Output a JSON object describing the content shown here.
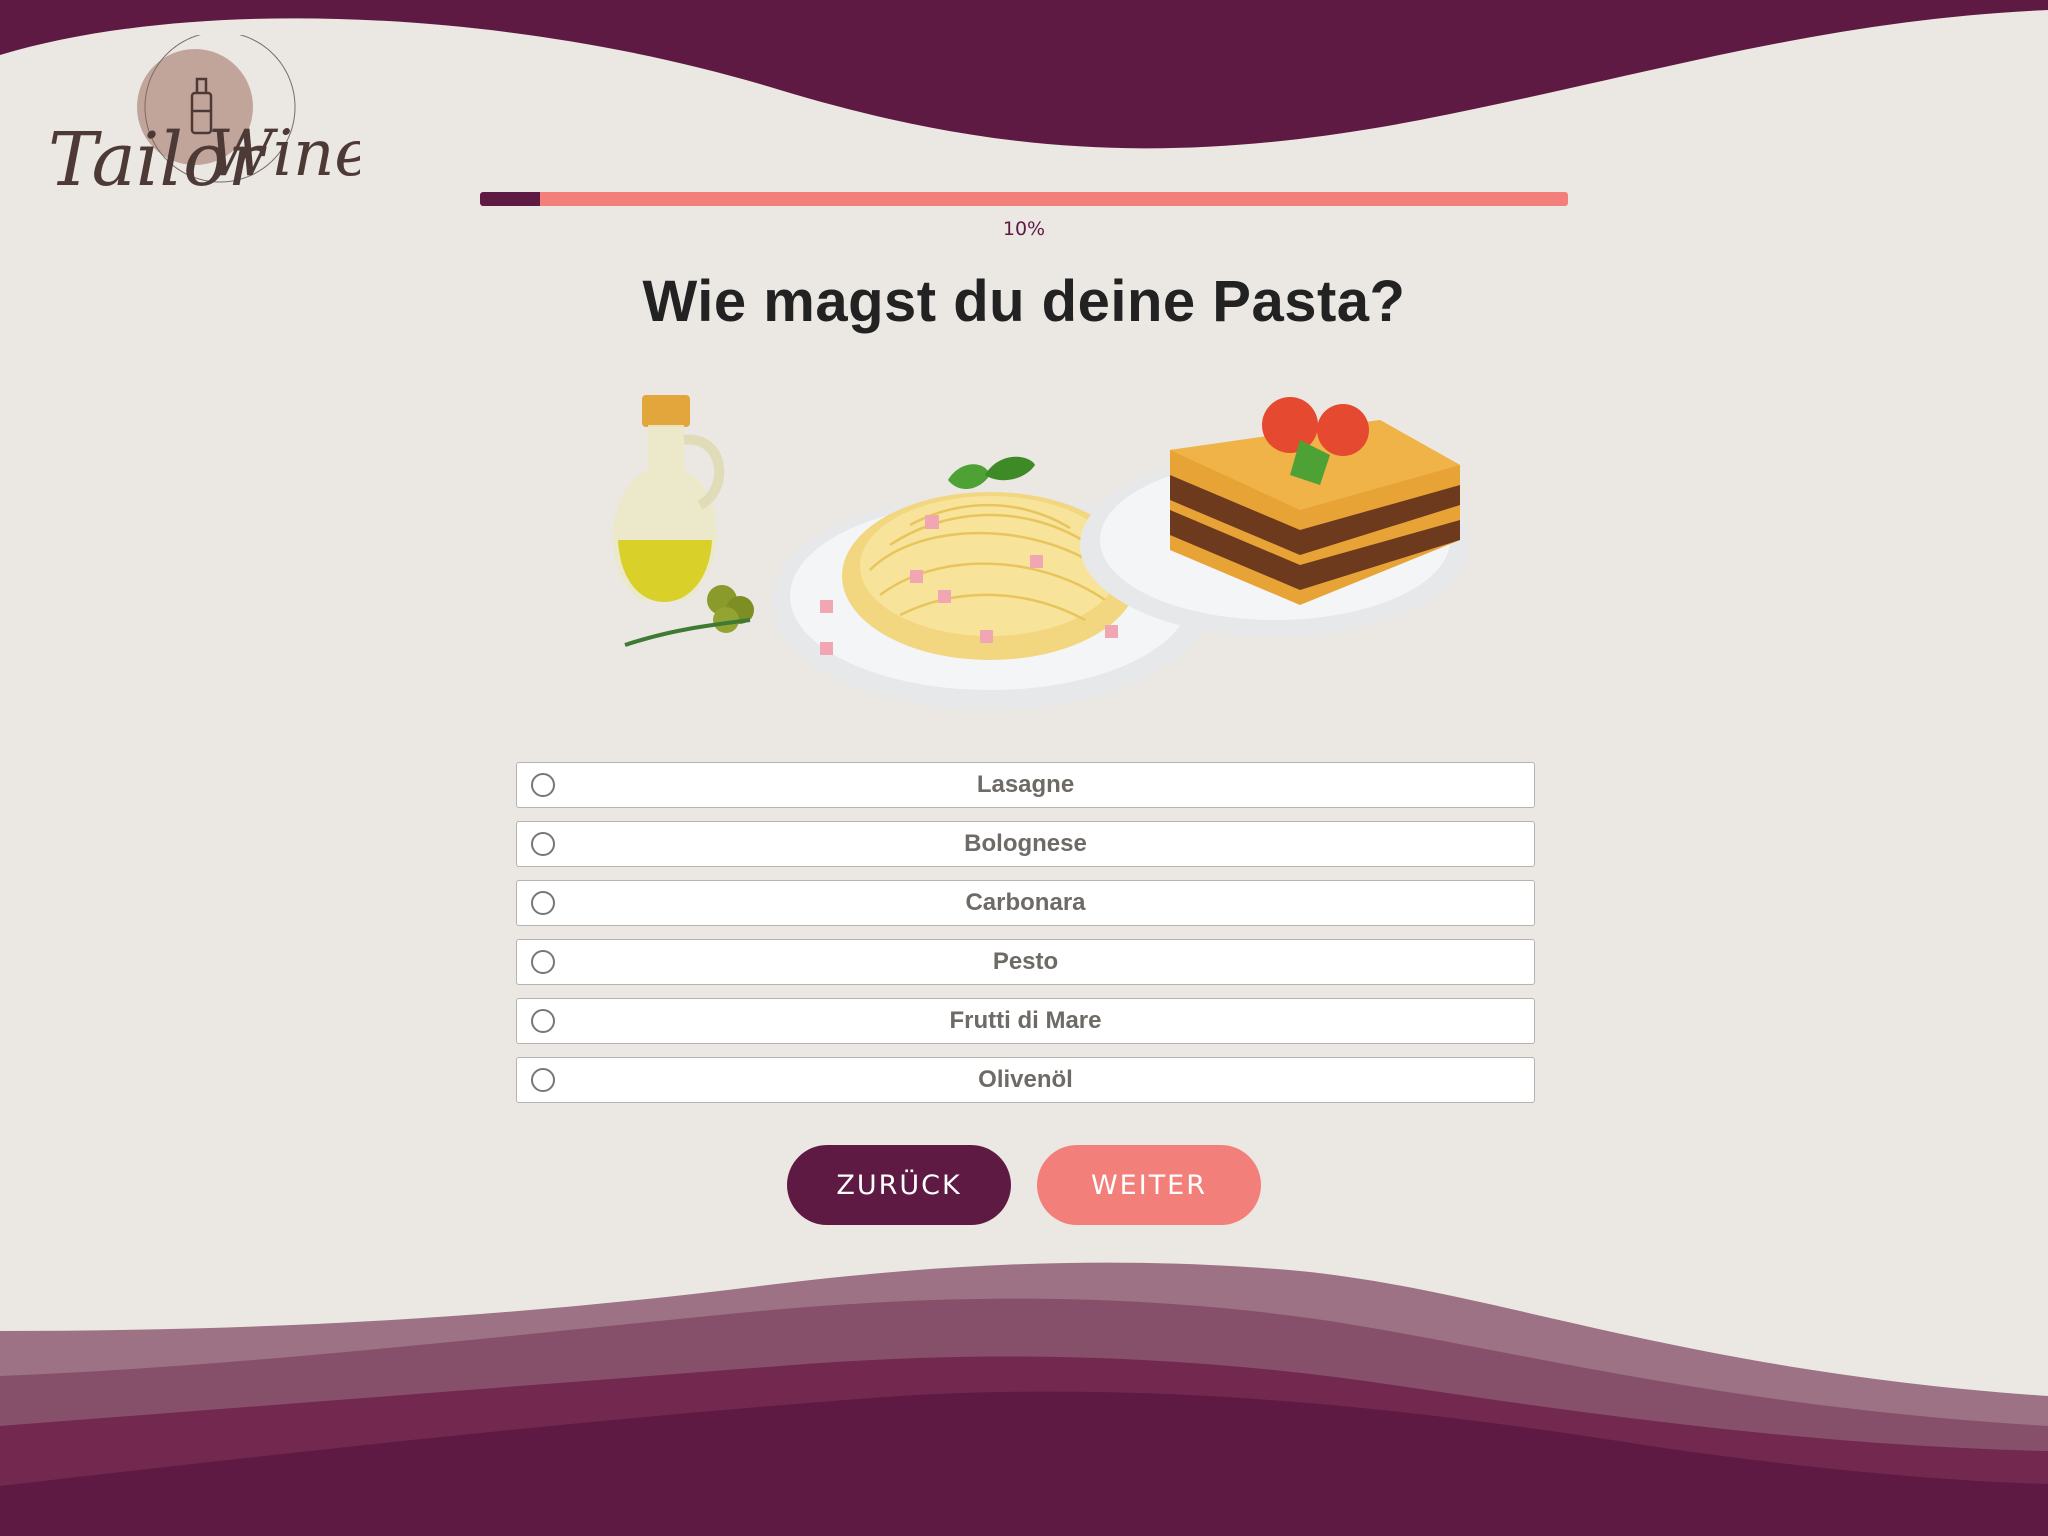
{
  "brand": {
    "logo_text": "TailorWine",
    "colors": {
      "primary": "#5e1a42",
      "accent": "#f27f79",
      "background": "#ebe7e3"
    }
  },
  "progress": {
    "percent": 10,
    "label": "10%"
  },
  "question": {
    "title": "Wie magst du deine Pasta?"
  },
  "illustration": {
    "items": [
      "olive-oil-bottle-icon",
      "spaghetti-plate-icon",
      "lasagne-plate-icon"
    ]
  },
  "options": [
    {
      "label": "Lasagne",
      "selected": false
    },
    {
      "label": "Bolognese",
      "selected": false
    },
    {
      "label": "Carbonara",
      "selected": false
    },
    {
      "label": "Pesto",
      "selected": false
    },
    {
      "label": "Frutti di Mare",
      "selected": false
    },
    {
      "label": "Olivenöl",
      "selected": false
    }
  ],
  "navigation": {
    "back_label": "ZURÜCK",
    "next_label": "WEITER"
  }
}
